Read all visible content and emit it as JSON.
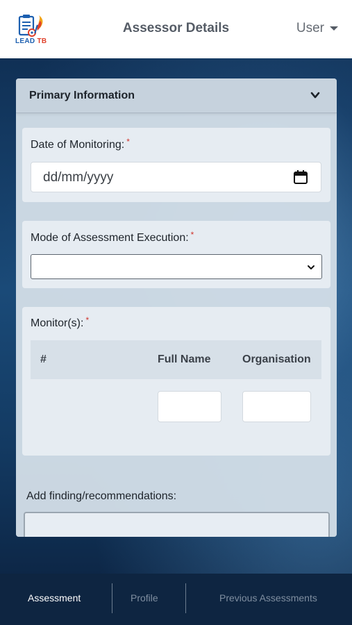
{
  "header": {
    "logo_text": "LEAD",
    "logo_text_accent": "TB",
    "title": "Assessor Details",
    "user_label": "User"
  },
  "card": {
    "title": "Primary Information",
    "date_field": {
      "label": "Date of Monitoring:",
      "required_mark": "*",
      "placeholder": "dd/mm/yyyy"
    },
    "mode_field": {
      "label": "Mode of Assessment Execution:",
      "required_mark": "*",
      "selected_value": ""
    },
    "monitors": {
      "label": "Monitor(s):",
      "required_mark": "*",
      "columns": [
        "#",
        "Full Name",
        "Organisation"
      ]
    },
    "findings": {
      "label": "Add finding/recommendations:"
    }
  },
  "bottom_nav": {
    "items": [
      {
        "label": "Assessment",
        "active": true
      },
      {
        "label": "Profile",
        "active": false
      },
      {
        "label": "Previous Assessments",
        "active": false
      }
    ]
  },
  "colors": {
    "required": "#d0342c",
    "nav_active": "#ffffff",
    "nav_inactive": "#7f8ea0",
    "header_bg": "#ffffff"
  }
}
